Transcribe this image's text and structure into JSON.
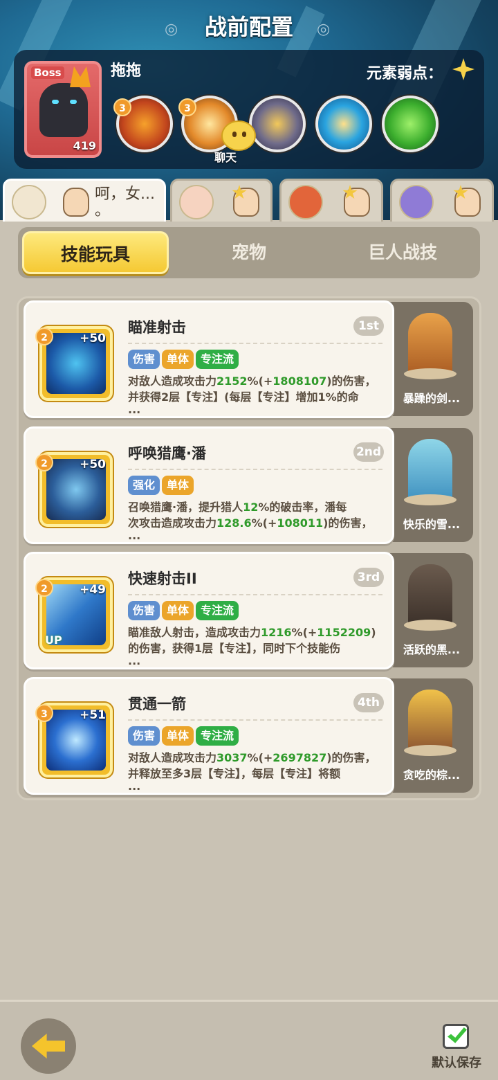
{
  "header": {
    "title": "战前配置",
    "boss_tag": "Boss",
    "boss_level": "419",
    "boss_name": "拖拖",
    "weakness_label": "元素弱点：",
    "weakness_icon": "light-element-icon",
    "boss_skills": [
      {
        "level": "3",
        "icon": "fire-beast-icon"
      },
      {
        "level": "3",
        "icon": "lightning-icon"
      },
      {
        "level": "",
        "icon": "armored-owl-icon"
      },
      {
        "level": "",
        "icon": "hourglass-icon"
      },
      {
        "level": "",
        "icon": "green-slime-icon"
      }
    ],
    "chat_label": "聊天"
  },
  "player_tabs": [
    {
      "text": "呵，女...\n。",
      "active": true
    },
    {
      "text": "",
      "active": false
    },
    {
      "text": "",
      "active": false
    },
    {
      "text": "",
      "active": false
    }
  ],
  "category_tabs": {
    "skills": "技能玩具",
    "pets": "宠物",
    "giant": "巨人战技"
  },
  "skills": [
    {
      "level": "2",
      "plus": "+50",
      "up": "",
      "title": "瞄准射击",
      "rank": "1st",
      "tags": [
        "伤害",
        "单体",
        "专注流"
      ],
      "desc_1a": "对敌人造成攻击力",
      "desc_1b": "2152",
      "desc_1c": "%(+",
      "desc_1d": "1808107",
      "desc_1e": ")的伤害，",
      "desc_2": "并获得2层【专注】(每层【专注】增加1%的命",
      "desc_3": "...",
      "pet_name": "暴躁的剑..."
    },
    {
      "level": "2",
      "plus": "+50",
      "up": "",
      "title": "呼唤猎鹰·潘",
      "rank": "2nd",
      "tags": [
        "强化",
        "单体"
      ],
      "desc_1a": "召唤猎鹰·潘，提升猎人",
      "desc_1b": "12",
      "desc_1c": "%的破击率，潘每",
      "desc_1d": "",
      "desc_1e": "",
      "desc_2a": "次攻击造成攻击力",
      "desc_2b": "128.6",
      "desc_2c": "%(+",
      "desc_2d": "108011",
      "desc_2e": ")的伤害，",
      "desc_3": "...",
      "pet_name": "快乐的雪..."
    },
    {
      "level": "2",
      "plus": "+49",
      "up": "UP",
      "title": "快速射击II",
      "rank": "3rd",
      "tags": [
        "伤害",
        "单体",
        "专注流"
      ],
      "desc_1a": "瞄准敌人射击，造成攻击力",
      "desc_1b": "1216",
      "desc_1c": "%(+",
      "desc_1d": "1152209",
      "desc_1e": ")",
      "desc_2": "的伤害，获得1层【专注】，同时下个技能伤",
      "desc_3": "...",
      "pet_name": "活跃的黑..."
    },
    {
      "level": "3",
      "plus": "+51",
      "up": "",
      "title": "贯通一箭",
      "rank": "4th",
      "tags": [
        "伤害",
        "单体",
        "专注流"
      ],
      "desc_1a": "对敌人造成攻击力",
      "desc_1b": "3037",
      "desc_1c": "%(+",
      "desc_1d": "2697827",
      "desc_1e": ")的伤害，",
      "desc_2": "并释放至多3层【专注】，每层【专注】将额",
      "desc_3": "...",
      "pet_name": "贪吃的棕..."
    }
  ],
  "tag_colors": {
    "伤害": "#5f8fcf",
    "单体": "#eba52a",
    "专注流": "#2fae45",
    "强化": "#5f8fcf"
  },
  "footer": {
    "save_label": "默认保存"
  }
}
